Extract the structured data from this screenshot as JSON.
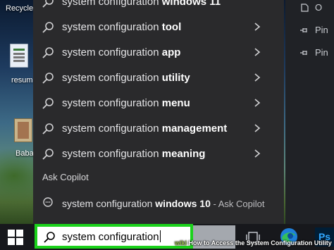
{
  "desktop": {
    "icons": [
      {
        "label": "Recycle",
        "icon": "recycle-bin-icon"
      },
      {
        "label": "resum",
        "icon": "document-icon"
      },
      {
        "label": "Baba",
        "icon": "book-icon"
      }
    ]
  },
  "right_panel": {
    "items": [
      {
        "label": "O",
        "icon": "file-icon"
      },
      {
        "label": "Pin",
        "icon": "pin-icon"
      },
      {
        "label": "Pin",
        "icon": "pin-icon"
      }
    ]
  },
  "search_results": {
    "query_prefix": "system configuration",
    "items": [
      {
        "bold": "windows 11"
      },
      {
        "bold": "tool"
      },
      {
        "bold": "app"
      },
      {
        "bold": "utility"
      },
      {
        "bold": "menu"
      },
      {
        "bold": "management"
      },
      {
        "bold": "meaning"
      }
    ]
  },
  "copilot": {
    "section_label": "Ask Copilot",
    "prefix": "system configuration",
    "bold": "windows 10",
    "suffix": " - Ask Copilot"
  },
  "taskbar": {
    "search_value": "system configuration",
    "ps_label": "Ps"
  },
  "watermark": {
    "brand": "wiki",
    "text": "How to Access the System Configuration Utility"
  },
  "colors": {
    "highlight_border": "#1bd21b",
    "panel_bg": "#2a2a2c",
    "taskbar_bg": "#17181c"
  }
}
